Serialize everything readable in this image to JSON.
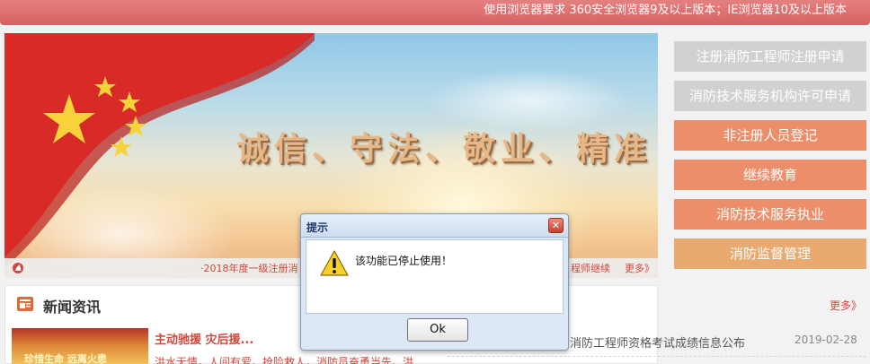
{
  "header": {
    "browser_requirement": "使用浏览器要求 360安全浏览器9及以上版本；IE浏览器10及以上版本"
  },
  "banner": {
    "slogan": "诚信、守法、敬业、精准",
    "ticker_left": "·2018年度一级注册消",
    "ticker_right": "程师继续",
    "ticker_more": "更多》"
  },
  "sidebar": {
    "items": [
      {
        "label": "注册消防工程师注册申请",
        "style": "gray"
      },
      {
        "label": "消防技术服务机构许可申请",
        "style": "gray"
      },
      {
        "label": "非注册人员登记",
        "style": "orange"
      },
      {
        "label": "继续教育",
        "style": "orange"
      },
      {
        "label": "消防技术服务执业",
        "style": "orange"
      },
      {
        "label": "消防监督管理",
        "style": "tan"
      }
    ]
  },
  "news": {
    "section_title": "新闻资讯",
    "more": "更多》",
    "headline": "主动驰援 灾后援...",
    "snippet": "洪水无情，人间有爱。抢险救人，消防员奋勇当先。洪",
    "thumb_caption": "珍惜生命 远离火患",
    "side_item_title": "消防工程师资格考试成绩信息公布",
    "side_item_date": "2019-02-28"
  },
  "dialog": {
    "title": "提示",
    "close_icon": "close-icon",
    "message": "该功能已停止使用！",
    "ok_label": "Ok"
  },
  "colors": {
    "accent_red": "#d0463c",
    "button_gray": "#d1d1d1",
    "button_orange": "#ed8e6a",
    "button_tan": "#eaa96f"
  }
}
